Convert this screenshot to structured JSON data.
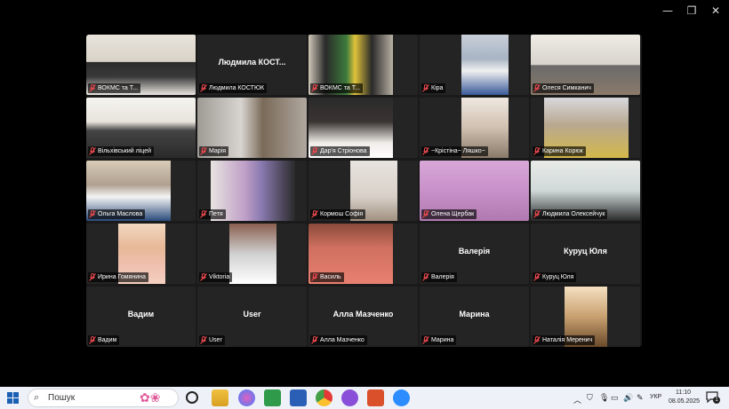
{
  "window": {
    "minimize_glyph": "—",
    "maximize_glyph": "❐",
    "close_glyph": "✕"
  },
  "tiles": [
    {
      "label": "ВОКМС та Т...",
      "video": true,
      "bg": "linear-gradient(180deg,#e8e4dc 0%,#d9d2c7 45%,#2b2b2b 46%,#3a3a3a 70%,#e9e6e0 100%)",
      "vx": 0,
      "vw": 123
    },
    {
      "label": "Людмила КОСТЮК",
      "big": "Людмила  КОСТ...",
      "video": false
    },
    {
      "label": "ВОКМС та Т...",
      "video": true,
      "bg": "linear-gradient(90deg,#cfc7b8 0%,#2a2a2a 20%,#3c7a3c 45%,#e0c23a 55%,#2a2a2a 75%,#b8b0a4 100%)",
      "vx": 0,
      "vw": 95
    },
    {
      "label": "Кіра",
      "video": true,
      "bg": "linear-gradient(180deg,#c9cfd8 0%,#a8b4c4 40%,#f0f0f0 60%,#3a5a9a 100%)",
      "vx": 47,
      "vw": 53
    },
    {
      "label": "Олеся Симканич",
      "video": true,
      "bg": "linear-gradient(180deg,#efece6 0%,#d8d4cc 50%,#6a6a6a 51%,#8a7a6a 100%)",
      "vx": 0,
      "vw": 123
    },
    {
      "label": "Вільхівський ліцей",
      "video": true,
      "bg": "linear-gradient(180deg,#f4f4f0 0%,#e8e4dc 40%,#444 55%,#2a2a2a 100%)",
      "vx": 0,
      "vw": 123,
      "active": true
    },
    {
      "label": "Марія",
      "video": true,
      "bg": "linear-gradient(90deg,#9e9a94 0%,#d8d4d0 40%,#7a6a58 60%,#b0a8a0 100%)",
      "vx": 0,
      "vw": 123
    },
    {
      "label": "Дар'я Стріонова",
      "video": true,
      "bg": "linear-gradient(180deg,#2a2a2a 0%,#3a3432 40%,#f0ece8 75%,#ffffff 100%)",
      "vx": 0,
      "vw": 95
    },
    {
      "label": "~Крістіна~ Ляшко~",
      "video": true,
      "bg": "linear-gradient(180deg,#efe8e0 0%,#d0c0b0 50%,#8a7a6a 100%)",
      "vx": 47,
      "vw": 53
    },
    {
      "label": "Карина Корюк",
      "video": true,
      "bg": "linear-gradient(180deg,#d8d8dc 0%,#b8a890 45%,#d4b84a 100%)",
      "vx": 15,
      "vw": 95
    },
    {
      "label": "Ольга Маслова",
      "video": true,
      "bg": "linear-gradient(180deg,#d8ccb8 0%,#b0a090 40%,#f4f4f4 60%,#2a4a7a 100%)",
      "vx": 0,
      "vw": 95
    },
    {
      "label": "Петя",
      "video": true,
      "bg": "linear-gradient(90deg,#e8e4e0 0%,#c0a0c8 40%,#8a7ab0 60%,#2a2a2a 100%)",
      "vx": 15,
      "vw": 95
    },
    {
      "label": "Кормош Софія",
      "video": true,
      "bg": "linear-gradient(180deg,#e8e4e0 0%,#d8d0c8 60%,#a09080 100%)",
      "vx": 47,
      "vw": 53
    },
    {
      "label": "Олена Щербак",
      "video": true,
      "bg": "linear-gradient(180deg,#d8a8d8 0%,#c890c8 50%,#b07ab0 100%)",
      "vx": 0,
      "vw": 123
    },
    {
      "label": "Людмила Олексейчук",
      "video": true,
      "bg": "linear-gradient(180deg,#e8ece8 0%,#d0d8d8 50%,#2a2a2a 100%)",
      "vx": 0,
      "vw": 123
    },
    {
      "label": "Ирина Гомянина",
      "video": true,
      "bg": "linear-gradient(180deg,#f0d8c0 0%,#e8b898 40%,#f0c0b0 70%,#f4d0c0 100%)",
      "vx": 36,
      "vw": 53
    },
    {
      "label": "Viktoria",
      "video": true,
      "bg": "linear-gradient(180deg,#8a6050 0%,#d0d0d0 50%,#ffffff 100%)",
      "vx": 36,
      "vw": 53
    },
    {
      "label": "Василь",
      "video": true,
      "bg": "linear-gradient(180deg,#8a4a3a 0%,#d07060 40%,#e88070 100%)",
      "vx": 0,
      "vw": 95
    },
    {
      "label": "Валерія",
      "big": "Валерія",
      "video": false
    },
    {
      "label": "Куруц Юля",
      "big": "Куруц Юля",
      "video": false
    },
    {
      "label": "Вадим",
      "big": "Вадим",
      "video": false
    },
    {
      "label": "User",
      "big": "User",
      "video": false
    },
    {
      "label": "Алла Мазченко",
      "big": "Алла Мазченко",
      "video": false
    },
    {
      "label": "Марина",
      "big": "Марина",
      "video": false
    },
    {
      "label": "Наталія Меренич",
      "video": true,
      "bg": "linear-gradient(180deg,#f4e0c0 0%,#c8a070 50%,#6a4a2a 100%)",
      "vx": 38,
      "vw": 48
    }
  ],
  "taskbar": {
    "search_placeholder": "Пошук",
    "language": "УКР",
    "time": "11:10",
    "date": "08.05.2025",
    "notification_count": "1"
  }
}
